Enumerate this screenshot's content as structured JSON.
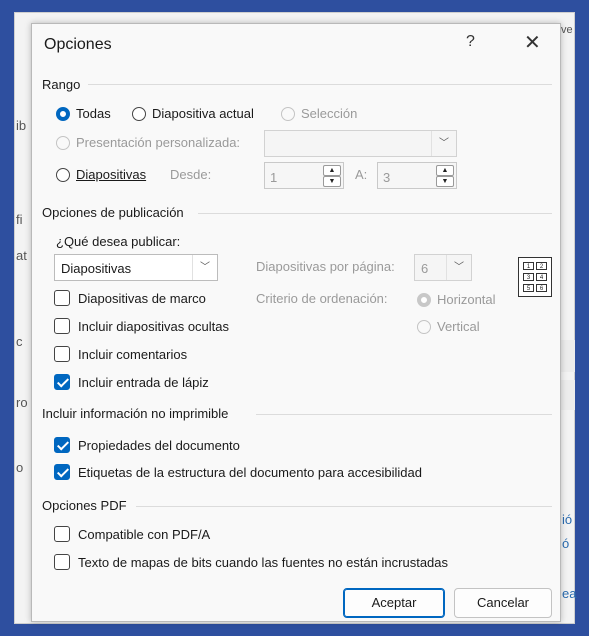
{
  "dialog": {
    "title": "Opciones",
    "help_label": "?",
    "close_label": "✕"
  },
  "rango": {
    "label": "Rango",
    "todas": "Todas",
    "diapositiva_actual": "Diapositiva actual",
    "seleccion": "Selección",
    "presentacion_personalizada": "Presentación personalizada:",
    "diapositivas": "Diapositivas",
    "desde_label": "Desde:",
    "desde_value": "1",
    "a_label": "A:",
    "a_value": "3",
    "selected": "Todas"
  },
  "publicacion": {
    "label": "Opciones de publicación",
    "que_publicar_label": "¿Qué desea publicar:",
    "que_publicar_value": "Diapositivas",
    "por_pagina_label": "Diapositivas por página:",
    "por_pagina_value": "6",
    "orden_label": "Criterio de ordenación:",
    "horizontal": "Horizontal",
    "vertical": "Vertical",
    "marco": "Diapositivas de marco",
    "ocultas": "Incluir diapositivas ocultas",
    "comentarios": "Incluir comentarios",
    "lapiz": "Incluir entrada de lápiz",
    "layout_numbers": [
      "1",
      "2",
      "3",
      "4",
      "5",
      "6"
    ]
  },
  "no_imprimible": {
    "label": "Incluir información no imprimible",
    "propiedades": "Propiedades del documento",
    "etiquetas": "Etiquetas de la estructura del documento para accesibilidad"
  },
  "pdf": {
    "label": "Opciones PDF",
    "compatible": "Compatible con PDF/A",
    "mapas_bits": "Texto de mapas de bits cuando las fuentes no están incrustadas"
  },
  "buttons": {
    "aceptar": "Aceptar",
    "cancelar": "Cancelar"
  },
  "background": {
    "edge_chars": [
      "ó",
      "ió",
      "ve",
      "ea",
      "ib",
      "at",
      "fi",
      "c",
      "ro",
      "o"
    ]
  },
  "colors": {
    "accent": "#0067c0",
    "frame": "#2e4f9f"
  }
}
